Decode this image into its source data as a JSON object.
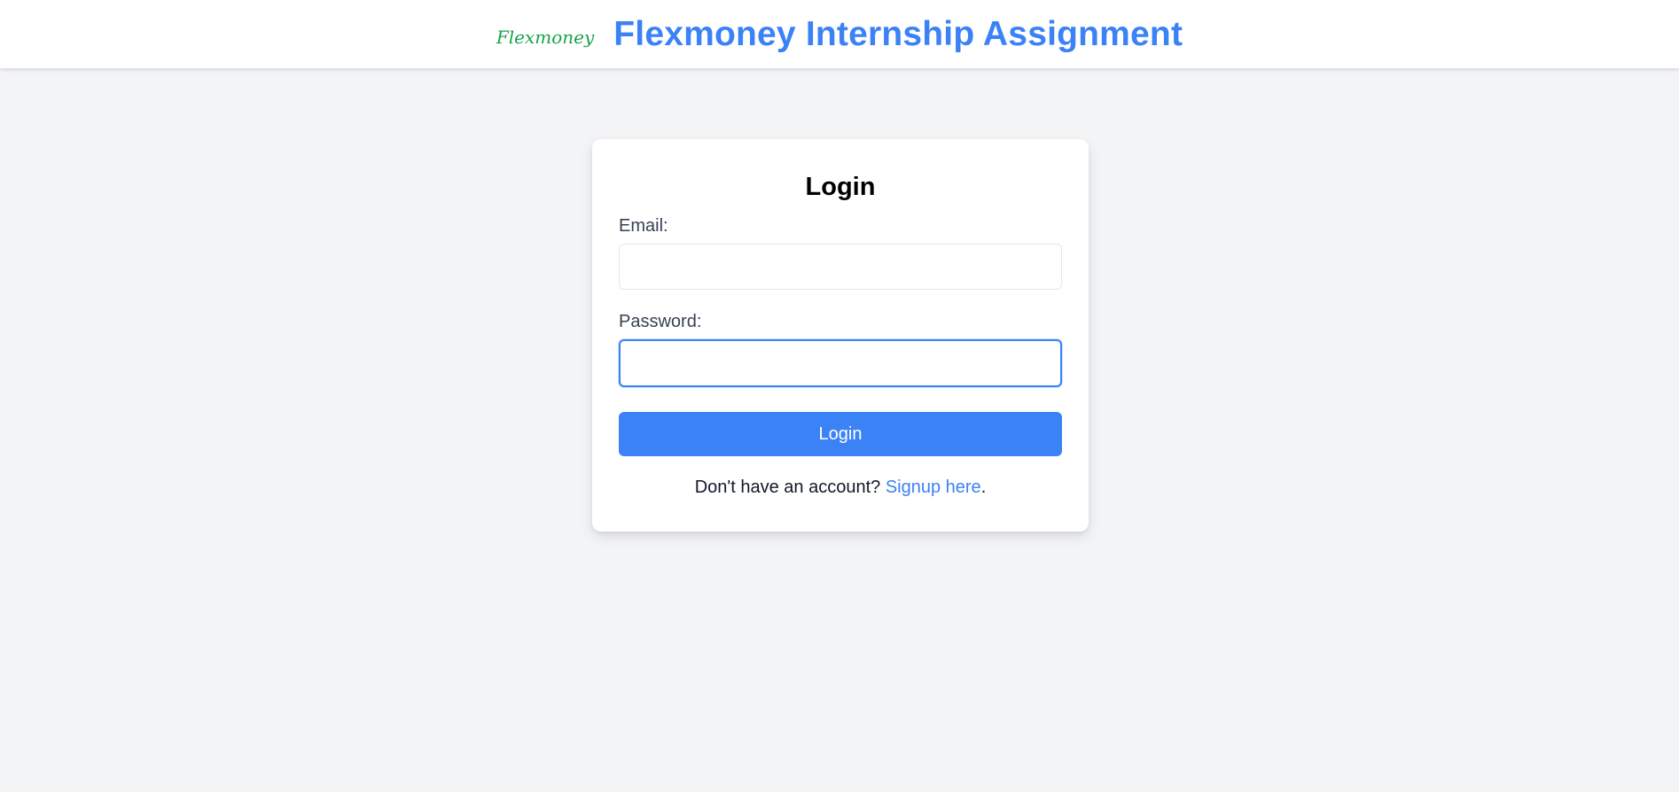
{
  "header": {
    "logo_text": "Flexmoney",
    "title": "Flexmoney Internship Assignment"
  },
  "login_card": {
    "title": "Login",
    "email_label": "Email:",
    "email_value": "",
    "password_label": "Password:",
    "password_value": "",
    "submit_label": "Login",
    "signup_prompt": "Don't have an account?",
    "signup_link": "Signup here",
    "signup_suffix": "."
  },
  "colors": {
    "brand_blue": "#3b82f6",
    "logo_green": "#16a34a",
    "page_background": "#f3f4f6"
  }
}
